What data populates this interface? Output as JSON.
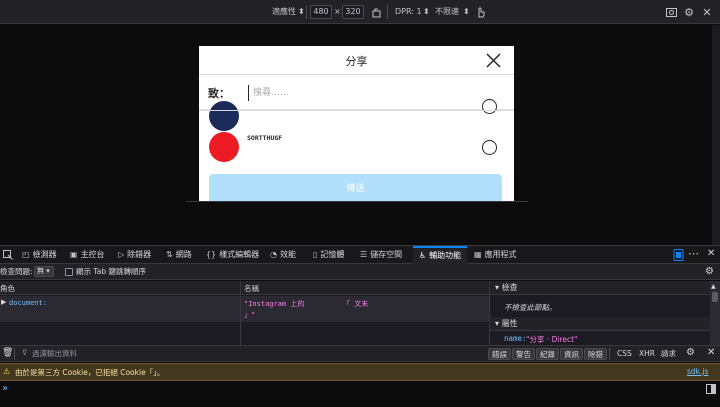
{
  "rdm_toolbar": {
    "device_select": "適應性",
    "width": "480",
    "times": "×",
    "height": "320",
    "dpr_label": "DPR: 1",
    "throttle": "不限速"
  },
  "page": {
    "modal_title": "分享",
    "to_label": "致：",
    "search_placeholder": "搜尋……",
    "user_name": "SORTTHUGF",
    "send_label": "傳送"
  },
  "devtools_tabs": [
    {
      "label": "檢測器",
      "icon": "inspector-icon"
    },
    {
      "label": "主控台",
      "icon": "console-icon"
    },
    {
      "label": "除錯器",
      "icon": "debugger-icon"
    },
    {
      "label": "網路",
      "icon": "network-icon"
    },
    {
      "label": "樣式編輯器",
      "icon": "style-editor-icon"
    },
    {
      "label": "效能",
      "icon": "performance-icon"
    },
    {
      "label": "記憶體",
      "icon": "memory-icon"
    },
    {
      "label": "儲存空間",
      "icon": "storage-icon"
    },
    {
      "label": "輔助功能",
      "icon": "accessibility-icon"
    },
    {
      "label": "應用程式",
      "icon": "application-icon"
    }
  ],
  "a11y_toolbar": {
    "check_issues": "檢查問題:",
    "check_issues_value": "無",
    "tab_order": "顯示 Tab 鍵跳轉順序"
  },
  "a11y_tree": {
    "col_role": "角色",
    "col_name": "名稱",
    "row_role": "document:",
    "row_name_line1": "\"Instagram 上的",
    "row_name_line1b": "「 文末",
    "row_name_line2": "」\""
  },
  "sidebar": {
    "checks_header": "檢查",
    "checks_text": "不檢查此節點。",
    "props_header": "屬性",
    "prop_key": "name:",
    "prop_value": "\"分享 · Direct\""
  },
  "console_toolbar": {
    "filter_placeholder": "過濾輸出資料",
    "filters": [
      "錯誤",
      "警告",
      "紀錄",
      "資訊",
      "除錯"
    ],
    "css": "CSS",
    "xhr": "XHR",
    "requests": "請求"
  },
  "console": {
    "warning_text": "由於是第三方 Cookie，已拒絕 Cookie「」。",
    "warning_source": "sdk.js",
    "prompt": "»"
  },
  "colors": {
    "accent": "#0a84ff",
    "send_button": "#b2dffc",
    "avatar_red": "#ed1c24",
    "avatar_navy": "#1c2a5a",
    "warning_bg": "#42381f"
  }
}
